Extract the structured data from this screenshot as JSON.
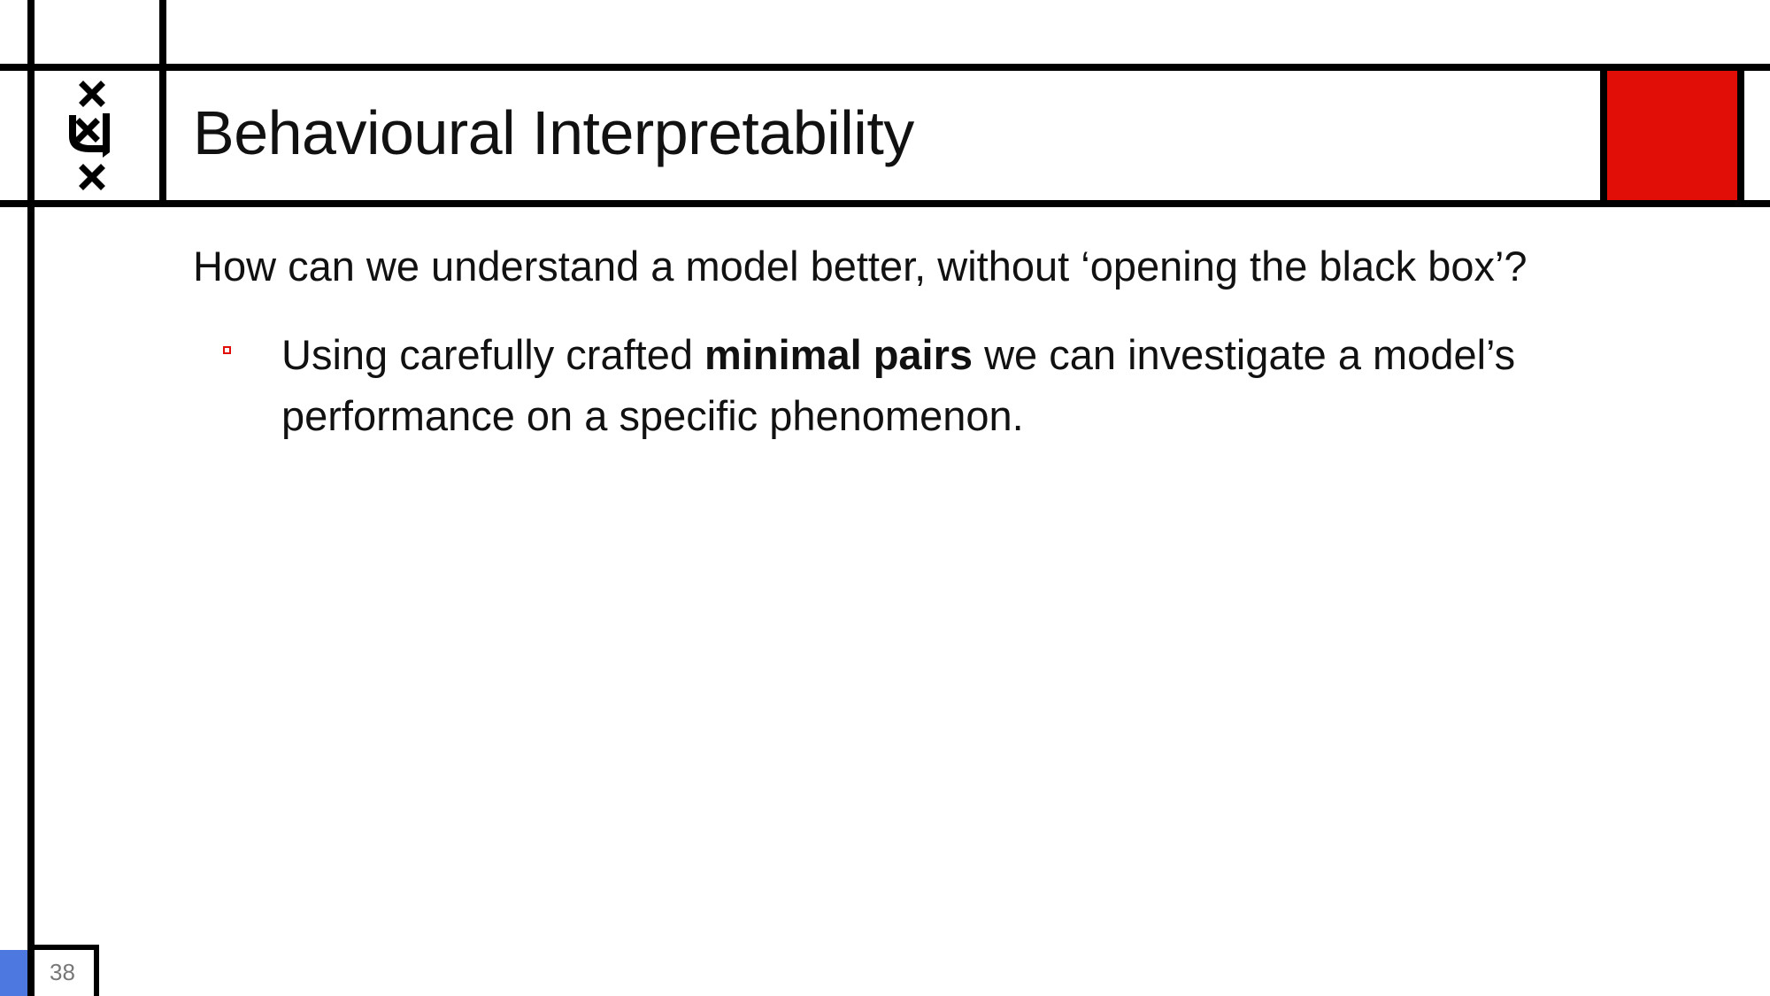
{
  "slide": {
    "title": "Behavioural Interpretability",
    "subtitle": "How can we understand a model better, without ‘opening the black box’?",
    "bullets": [
      {
        "text_before": "Using carefully crafted ",
        "bold": "minimal pairs",
        "text_after": " we can investigate a model’s performance on a specific phenomenon."
      }
    ],
    "page_number": "38"
  },
  "colors": {
    "accent_red": "#e00e06",
    "accent_blue": "#4c78e0",
    "frame": "#000000"
  },
  "icons": {
    "logo": "university-crest-icon",
    "bullet": "hollow-square-bullet-icon"
  }
}
